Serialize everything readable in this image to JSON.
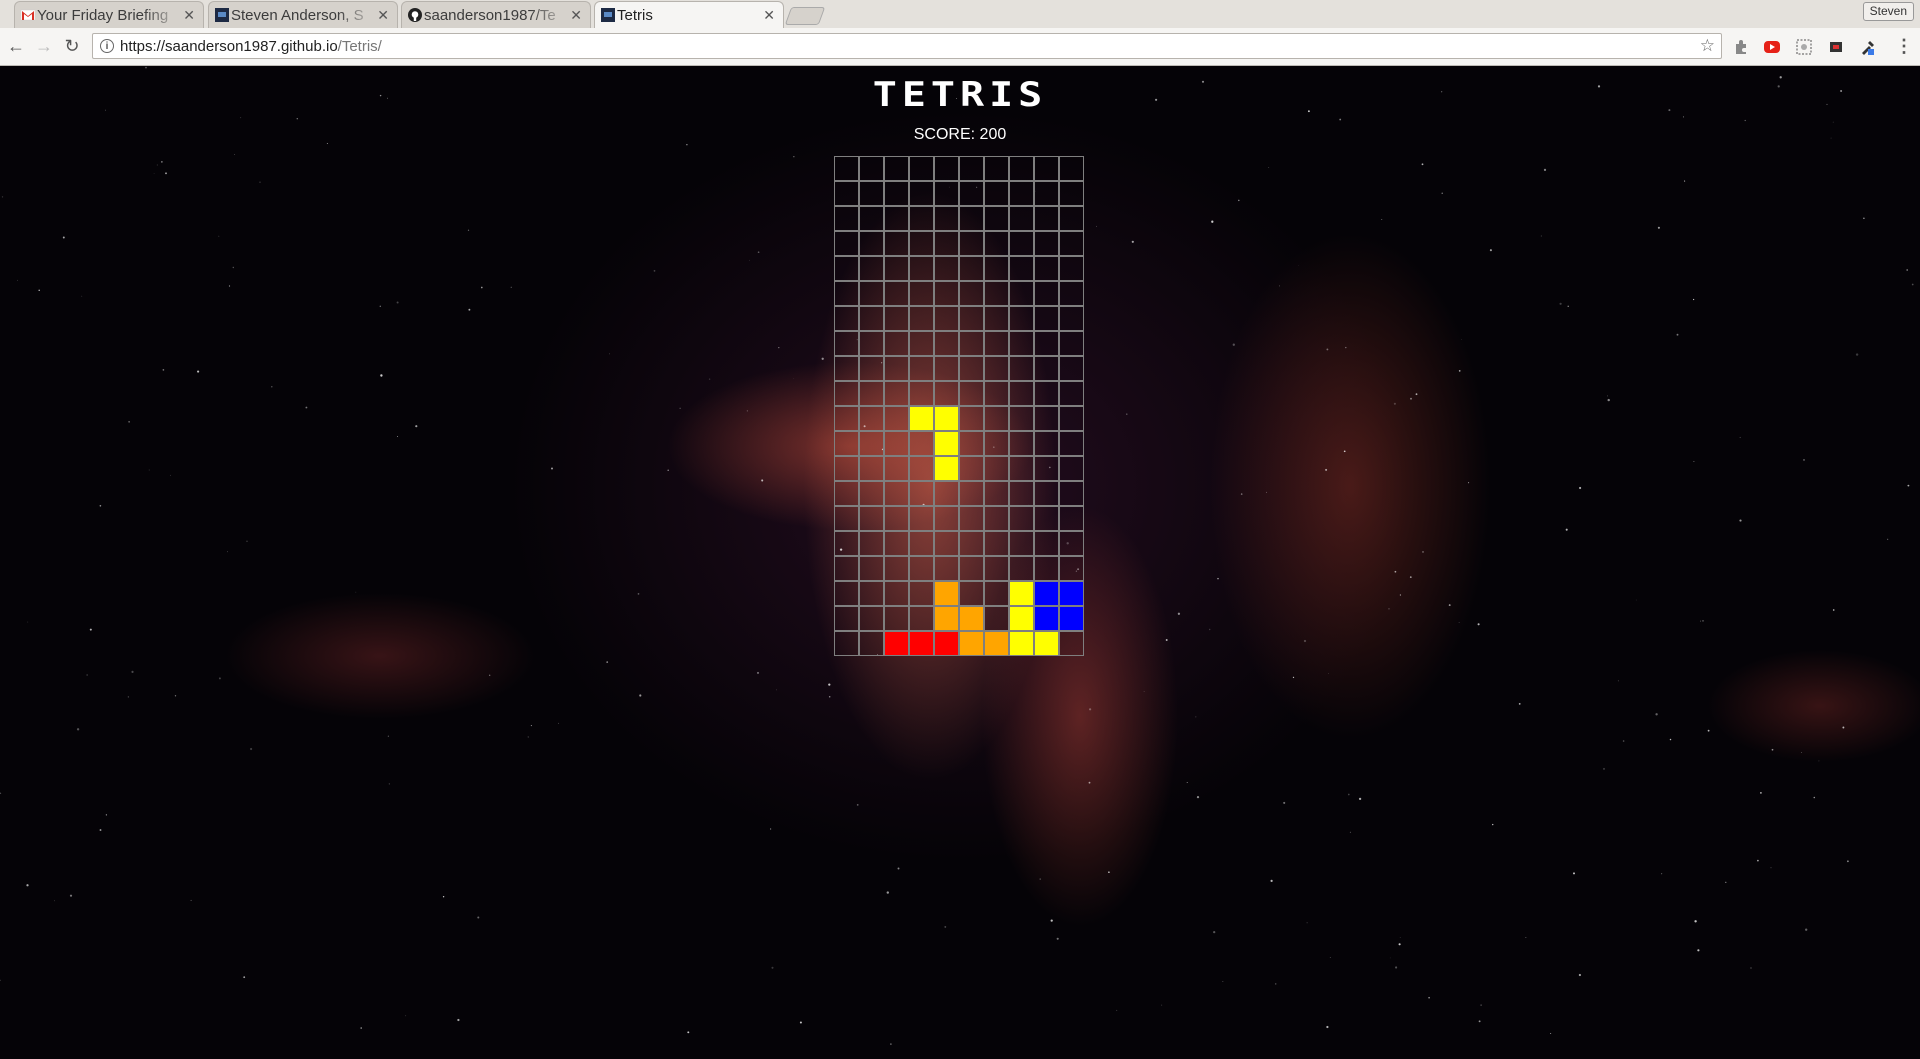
{
  "browser": {
    "tabs": [
      {
        "label": "Your Friday Briefing",
        "icon": "gmail-icon",
        "active": false
      },
      {
        "label": "Steven Anderson, S",
        "icon": "site-icon",
        "active": false
      },
      {
        "label": "saanderson1987/Te",
        "icon": "github-icon",
        "active": false
      },
      {
        "label": "Tetris",
        "icon": "site-icon",
        "active": true
      }
    ],
    "profile_name": "Steven",
    "url_host": "https://saanderson1987.github.io",
    "url_path": "/Tetris/"
  },
  "game": {
    "title": "TETRIS",
    "score_label": "SCORE: 200",
    "board": {
      "columns": 10,
      "rows": 20,
      "colors": {
        "Y": "#ffff00",
        "O": "#ffa500",
        "B": "#0000ff",
        "R": "#ff0000"
      },
      "grid": [
        "..........",
        "..........",
        "..........",
        "..........",
        "..........",
        "..........",
        "..........",
        "..........",
        "..........",
        "..........",
        "...YY.....",
        "....Y.....",
        "....Y.....",
        "..........",
        "..........",
        "..........",
        "..........",
        "....O..YBB",
        "....OO.YBB",
        "..RRROOYY."
      ]
    }
  }
}
